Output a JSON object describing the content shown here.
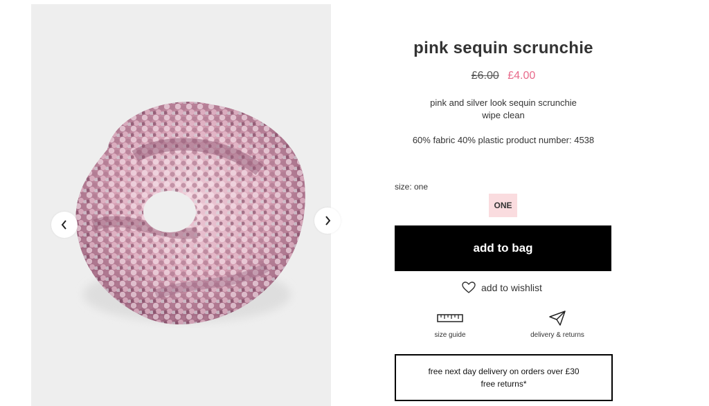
{
  "gallery": {
    "prev_arrow_icon": "chevron-left-icon",
    "next_arrow_icon": "chevron-right-icon",
    "image_subject": "pink sequin scrunchie"
  },
  "product": {
    "title": "pink sequin scrunchie",
    "price_original": "£6.00",
    "price_sale": "£4.00",
    "description_line1": "pink and silver look sequin scrunchie",
    "description_line2": "wipe clean",
    "composition_and_number": "60% fabric 40% plastic product number: 4538"
  },
  "size": {
    "label": "size: one",
    "options": [
      "ONE"
    ],
    "selected": "ONE"
  },
  "actions": {
    "add_to_bag": "add to bag",
    "add_to_wishlist": "add to wishlist"
  },
  "utilities": {
    "size_guide": "size guide",
    "delivery_returns": "delivery & returns"
  },
  "promo": {
    "line1": "free next day delivery on orders over £30",
    "line2": "free returns*"
  },
  "colors": {
    "sale_price": "#e8698a",
    "size_selected_bg": "#fadcdf",
    "primary_button": "#000000",
    "gallery_bg": "#eeeeee"
  }
}
